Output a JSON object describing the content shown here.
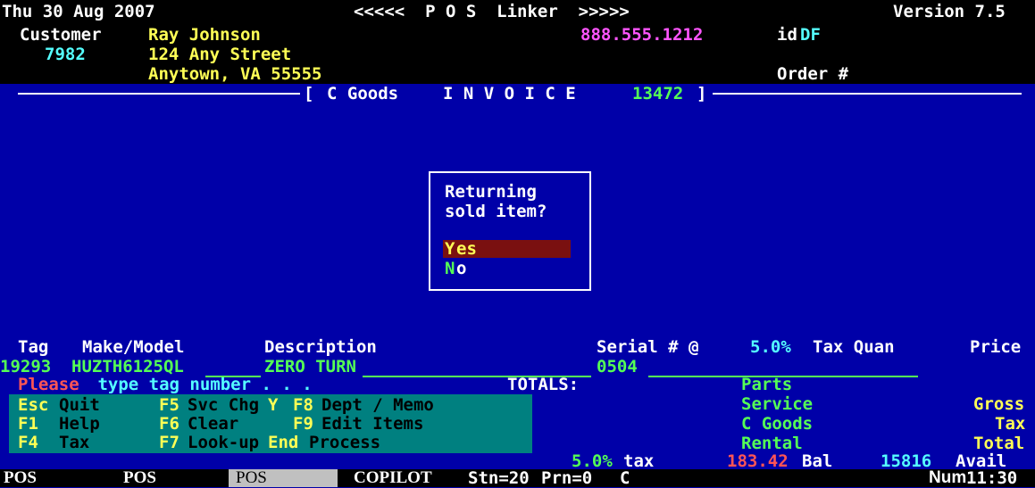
{
  "header": {
    "date": "Thu 30 Aug 2007",
    "app_title": "<<<<<  P O S  Linker  >>>>>",
    "version": "Version 7.5",
    "customer_label": "Customer",
    "customer_name": "Ray Johnson",
    "phone": "888.555.1212",
    "id_label": "id",
    "id_value": "DF",
    "customer_number": "7982",
    "address1": "124 Any Street",
    "address2": "Anytown, VA 55555",
    "order_label": "Order #"
  },
  "invoice": {
    "open_bracket": "[",
    "type": "C Goods",
    "title": "I N V O I C E",
    "number": "13472",
    "close_bracket": "]"
  },
  "dialog": {
    "line1": "Returning",
    "line2": "sold item?",
    "yes_hotkey": "Y",
    "yes_rest": "es",
    "no_hotkey": "N",
    "no_rest": "o"
  },
  "item_table": {
    "headers": {
      "tag": "Tag",
      "make_model": "Make/Model",
      "description": "Description",
      "serial": "Serial # @",
      "tax_rate": "5.0%",
      "tax_quan": "Tax Quan",
      "price": "Price"
    },
    "row": {
      "tag": "19293",
      "make_model": "HUZTH6125QL",
      "description": "ZERO TURN",
      "serial": "0504"
    }
  },
  "prompt": {
    "highlight": "Please",
    "rest": " type tag number . . ."
  },
  "totals": {
    "label": "TOTALS:",
    "categories": [
      "Parts",
      "Service",
      "C Goods",
      "Rental"
    ],
    "right_labels": [
      "Gross",
      "Tax",
      "Total"
    ],
    "tax_rate": "5.0%",
    "tax_label": "tax",
    "balance": "183.42",
    "balance_label": "Bal",
    "available": "15816",
    "available_label": "Avail"
  },
  "function_keys": [
    {
      "key": "Esc",
      "label": "Quit"
    },
    {
      "key": "F5",
      "label": "Svc Chg",
      "suffix": "Y"
    },
    {
      "key": "F8",
      "label": "Dept / Memo"
    },
    {
      "key": "F1",
      "label": "Help"
    },
    {
      "key": "F6",
      "label": "Clear"
    },
    {
      "key": "F9",
      "label": "Edit Items"
    },
    {
      "key": "F4",
      "label": "Tax"
    },
    {
      "key": "F7",
      "label": "Look-up"
    },
    {
      "key": "End",
      "label": "Process"
    }
  ],
  "taskbar": {
    "tabs": [
      "POS",
      "POS",
      "POS",
      "COPILOT"
    ],
    "station": "Stn=20",
    "printer": "Prn=0",
    "mode": "C",
    "num_lock": "Num",
    "time": "11:30"
  },
  "colors": {
    "background": "#0000a8",
    "header_background": "#000000",
    "panel": "#008080",
    "selection": "#7a1010"
  }
}
